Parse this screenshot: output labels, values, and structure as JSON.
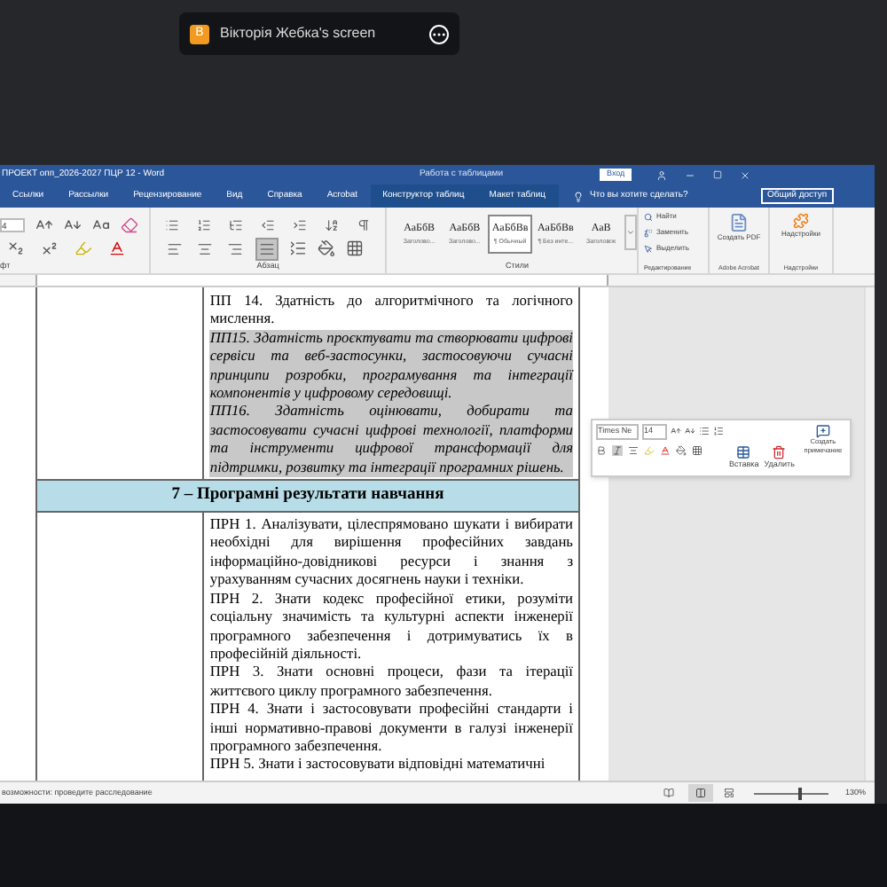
{
  "screen_share": {
    "initial": "В",
    "label": "Вікторія Жебка's screen"
  },
  "window": {
    "title": "ПРОЕКТ опп_2026-2027 ПЦР 12  -  Word",
    "context": "Работа с таблицами",
    "sign_in": "Вход"
  },
  "tabs": [
    {
      "label": "Ссылки",
      "selected": false,
      "contextual": false
    },
    {
      "label": "Рассылки",
      "selected": false,
      "contextual": false
    },
    {
      "label": "Рецензирование",
      "selected": false,
      "contextual": false
    },
    {
      "label": "Вид",
      "selected": false,
      "contextual": false
    },
    {
      "label": "Справка",
      "selected": false,
      "contextual": false
    },
    {
      "label": "Acrobat",
      "selected": false,
      "contextual": false
    },
    {
      "label": "Конструктор таблиц",
      "selected": false,
      "contextual": true
    },
    {
      "label": "Макет таблиц",
      "selected": false,
      "contextual": true
    }
  ],
  "tell_me": "Что вы хотите сделать?",
  "share": "Общий доступ",
  "ribbon": {
    "font_size": "4",
    "alignments": [
      {
        "kind": "left",
        "selected": false
      },
      {
        "kind": "center",
        "selected": false
      },
      {
        "kind": "right",
        "selected": false
      },
      {
        "kind": "justify",
        "selected": true
      }
    ],
    "styles": [
      {
        "sample": "АаБбВ",
        "name": "Заголово...",
        "selected": false
      },
      {
        "sample": "АаБбВ",
        "name": "Заголово...",
        "selected": false
      },
      {
        "sample": "АаБбВв",
        "name": "¶ Обычный",
        "selected": true
      },
      {
        "sample": "АаБбВв",
        "name": "¶ Без инте...",
        "selected": false
      },
      {
        "sample": "АаВ",
        "name": "Заголовок",
        "selected": false
      }
    ],
    "editing": [
      "Найти",
      "Заменить",
      "Выделить"
    ],
    "acrobat": "Создать PDF",
    "addins": "Надстройки",
    "groups": [
      "фт",
      "Абзац",
      "Стили",
      "Редактирование",
      "Adobe Acrobat",
      "Надстройки"
    ]
  },
  "document": {
    "paragraphs_top": [
      {
        "text": "ПП 14. Здатність до алгоритмічного та логічного мислення.",
        "italic": false,
        "selected": false
      },
      {
        "text": "ПП15. Здатність проєктувати та створювати цифрові сервіси та веб-застосунки, застосовуючи сучасні принципи розробки, програмування та інтеграції компонентів у цифровому середовищі.",
        "italic": true,
        "selected": true
      },
      {
        "text": "ПП16. Здатність оцінювати, добирати та застосовувати сучасні цифрові технології, платформи та інструменти цифрової трансформації для підтримки, розвитку та інтеграції програмних рішень.",
        "italic": true,
        "selected": true
      }
    ],
    "section_header": "7 – Програмні результати навчання",
    "paragraphs_bottom": [
      {
        "text": "ПРН 1. Аналізувати, цілеспрямовано шукати і вибирати необхідні для вирішення професійних завдань інформаційно-довідникові ресурси і знання з урахуванням сучасних досягнень науки і техніки.",
        "italic": false,
        "selected": false
      },
      {
        "text": "ПРН 2. Знати кодекс професійної етики, розуміти соціальну значимість та культурні аспекти інженерії програмного забезпечення і дотримуватись їх в професійній діяльності.",
        "italic": false,
        "selected": false
      },
      {
        "text": "ПРН 3. Знати основні процеси, фази та ітерації життєвого циклу програмного забезпечення.",
        "italic": false,
        "selected": false
      },
      {
        "text": "ПРН 4. Знати і застосовувати професійні стандарти і інші нормативно-правові документи в галузі інженерії програмного забезпечення.",
        "italic": false,
        "selected": false
      },
      {
        "text": "ПРН 5. Знати і застосовувати відповідні математичні",
        "italic": false,
        "selected": false
      }
    ]
  },
  "mini_toolbar": {
    "font": "Times Ne",
    "size": "14",
    "insert": "Вставка",
    "delete": "Удалить",
    "comment": "Создать примечание"
  },
  "status_bar": {
    "text": "возможности: проведите расследование",
    "zoom": "130%",
    "level": 0.58
  }
}
